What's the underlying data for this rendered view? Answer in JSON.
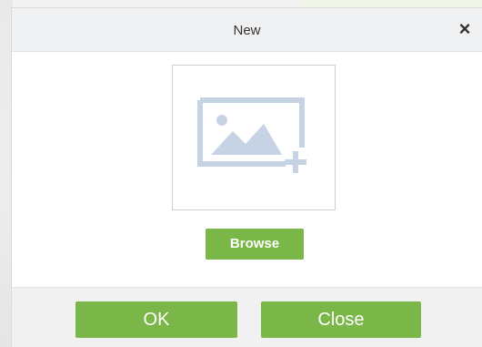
{
  "dialog": {
    "title": "New",
    "close_icon": "×"
  },
  "upload": {
    "icon": "image-add-icon"
  },
  "browse_label": "Browse",
  "footer": {
    "ok_label": "OK",
    "close_label": "Close"
  },
  "colors": {
    "accent": "#7ab648",
    "icon": "#c5d3e4",
    "titlebar": "#f0f1f3"
  }
}
